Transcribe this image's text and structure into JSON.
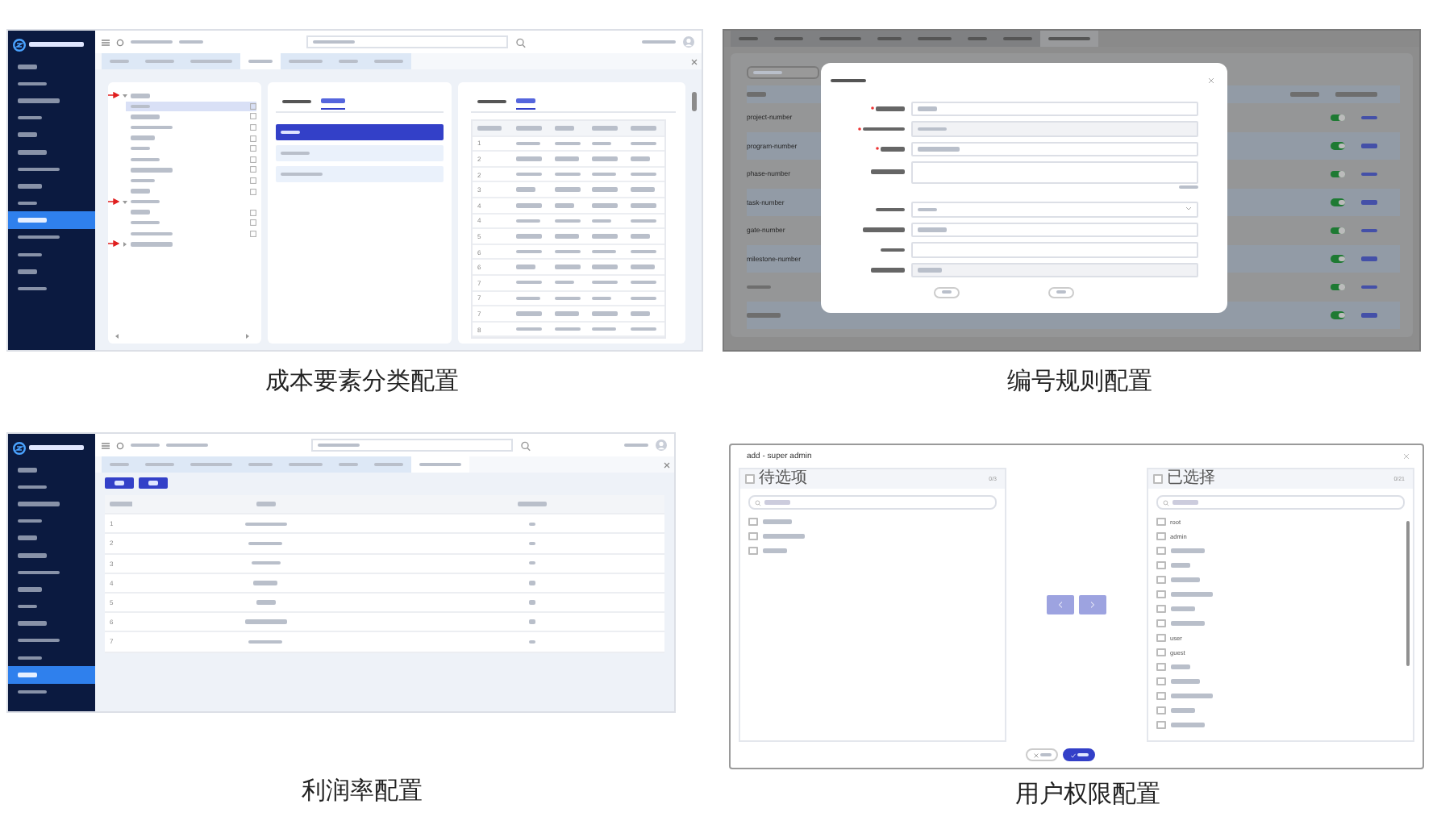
{
  "panels": [
    {
      "kind": "cost_elements",
      "caption": "成本要素分类配置",
      "tabs": [
        {
          "selected": false
        },
        {
          "selected": false
        },
        {
          "selected": false
        },
        {
          "selected": true
        },
        {
          "selected": false
        },
        {
          "selected": false
        },
        {
          "selected": false
        }
      ],
      "category_tabs": [
        {
          "selected": false
        },
        {
          "selected": true
        }
      ],
      "attribute_tabs": [
        {
          "selected": false
        },
        {
          "selected": true
        }
      ],
      "sidebar": [
        {
          "selected": false
        },
        {
          "selected": false
        },
        {
          "selected": false
        },
        {
          "selected": false
        },
        {
          "selected": false
        },
        {
          "selected": false
        },
        {
          "selected": false
        },
        {
          "selected": false
        },
        {
          "selected": false
        },
        {
          "selected": true
        },
        {
          "selected": false
        },
        {
          "selected": false
        },
        {
          "selected": false
        },
        {
          "selected": false
        }
      ],
      "tree": [
        {
          "expanded": true,
          "children": [
            {
              "selected": true
            },
            {
              "selected": false
            },
            {
              "selected": false
            },
            {
              "selected": false
            },
            {
              "selected": false
            },
            {
              "selected": false
            },
            {
              "selected": false
            },
            {
              "selected": false
            },
            {
              "selected": false
            }
          ]
        },
        {
          "expanded": true,
          "children": [
            {
              "selected": false
            },
            {
              "selected": false
            },
            {
              "selected": false
            }
          ]
        },
        {
          "expanded": false
        }
      ],
      "middle_items": [
        {
          "selected": true
        },
        {
          "selected": false
        },
        {
          "selected": false
        }
      ],
      "table_rows": [
        "1",
        "2",
        "2",
        "3",
        "4",
        "4",
        "5",
        "6",
        "6",
        "7",
        "7",
        "7",
        "8"
      ]
    },
    {
      "kind": "numbering",
      "caption": "编号规则配置",
      "tabs": [
        {
          "selected": false
        },
        {
          "selected": false
        },
        {
          "selected": false
        },
        {
          "selected": false
        },
        {
          "selected": false
        },
        {
          "selected": false
        },
        {
          "selected": false
        },
        {
          "selected": true
        }
      ],
      "rows": [
        {
          "code": "project-number",
          "enabled": true
        },
        {
          "code": "program-number",
          "enabled": true
        },
        {
          "code": "phase-number",
          "enabled": true
        },
        {
          "code": "task-number",
          "enabled": true
        },
        {
          "code": "gate-number",
          "enabled": true
        },
        {
          "code": "milestone-number",
          "enabled": true
        },
        {
          "enabled": true
        },
        {
          "enabled": true
        }
      ]
    },
    {
      "kind": "profit",
      "caption": "利润率配置",
      "tabs": [
        {
          "selected": false
        },
        {
          "selected": false
        },
        {
          "selected": false
        },
        {
          "selected": false
        },
        {
          "selected": false
        },
        {
          "selected": false
        },
        {
          "selected": false
        },
        {
          "selected": true
        }
      ],
      "sidebar": [
        {
          "selected": false
        },
        {
          "selected": false
        },
        {
          "selected": false
        },
        {
          "selected": false
        },
        {
          "selected": false
        },
        {
          "selected": false
        },
        {
          "selected": false
        },
        {
          "selected": false
        },
        {
          "selected": false
        },
        {
          "selected": false
        },
        {
          "selected": false
        },
        {
          "selected": false
        },
        {
          "selected": true
        },
        {
          "selected": false
        }
      ],
      "rows": [
        "1",
        "2",
        "3",
        "4",
        "5",
        "6",
        "7"
      ]
    },
    {
      "kind": "permissions",
      "caption": "用户权限配置",
      "title": "add - super admin",
      "source": {
        "title": "待选项",
        "all_checked": false,
        "count": "0/3",
        "items": [
          {
            "checked": false
          },
          {
            "checked": false
          },
          {
            "checked": false
          }
        ]
      },
      "target": {
        "title": "已选择",
        "all_checked": false,
        "count": "0/21",
        "items": [
          {
            "label": "root",
            "checked": false
          },
          {
            "label": "admin",
            "checked": false
          },
          {
            "checked": false
          },
          {
            "checked": false
          },
          {
            "checked": false
          },
          {
            "checked": false
          },
          {
            "checked": false
          },
          {
            "checked": false
          },
          {
            "label": "user",
            "checked": false
          },
          {
            "label": "guest",
            "checked": false
          },
          {
            "checked": false
          },
          {
            "checked": false
          },
          {
            "checked": false
          },
          {
            "checked": false
          },
          {
            "checked": false
          }
        ]
      }
    }
  ]
}
